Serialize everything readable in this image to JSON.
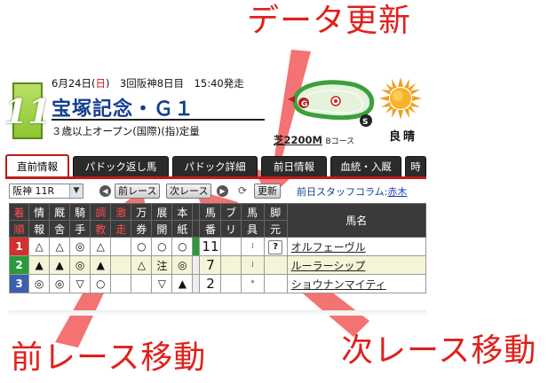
{
  "annotations": {
    "data_update": "データ更新",
    "prev_race_move": "前レース移動",
    "next_race_move": "次レース移動"
  },
  "header": {
    "race_number": "11",
    "date_prefix": "6月24日(",
    "weekday": "日",
    "date_suffix": ")　3回阪神8日目　15:40発走",
    "race_name": "宝塚記念・Ｇ１",
    "conditions": "３歳以上オープン(国際)(指)定量",
    "distance": "芝2200M",
    "course": "Bコース",
    "weather": "良晴",
    "weather_track": "良",
    "weather_sky": "晴"
  },
  "tabs": [
    "直前情報",
    "パドック返し馬",
    "パドック詳細",
    "前日情報",
    "血統・入厩",
    "時"
  ],
  "nav": {
    "race_select": "阪神 11R",
    "prev_label": "前レース",
    "next_label": "次レース",
    "update_label": "更新",
    "column_prefix": "前日スタッフコラム:",
    "column_author": "赤木"
  },
  "table": {
    "headers": [
      {
        "top": "着",
        "bottom": "順",
        "red": true
      },
      {
        "top": "情",
        "bottom": "報",
        "red": false
      },
      {
        "top": "厩",
        "bottom": "舎",
        "red": false
      },
      {
        "top": "騎",
        "bottom": "手",
        "red": false
      },
      {
        "top": "調",
        "bottom": "教",
        "red": true
      },
      {
        "top": "激",
        "bottom": "走",
        "red": true
      },
      {
        "top": "万",
        "bottom": "券",
        "red": false
      },
      {
        "top": "展",
        "bottom": "開",
        "red": false
      },
      {
        "top": "本",
        "bottom": "紙",
        "red": false
      },
      {
        "top": "",
        "bottom": "",
        "red": false
      },
      {
        "top": "馬",
        "bottom": "番",
        "red": false
      },
      {
        "top": "ブ",
        "bottom": "リ",
        "red": false
      },
      {
        "top": "馬",
        "bottom": "具",
        "red": false
      },
      {
        "top": "脚",
        "bottom": "元",
        "red": false
      },
      {
        "top": "馬名",
        "bottom": "",
        "red": false
      }
    ],
    "rows": [
      {
        "waku": "1",
        "waku_color": "#d0312d",
        "marks": [
          "△",
          "△",
          "◎",
          "△",
          "",
          "○",
          "○",
          "○"
        ],
        "umaban": "11",
        "bri": "",
        "gu": "⁞",
        "ashi": "?",
        "name": "オルフェーヴル"
      },
      {
        "waku": "2",
        "waku_color": "#2a9a3a",
        "marks": [
          "▲",
          "▲",
          "◎",
          "▲",
          "",
          "△",
          "注",
          "◎"
        ],
        "umaban": "7",
        "bri": "",
        "gu": "⁞",
        "ashi": "",
        "name": "ルーラーシップ"
      },
      {
        "waku": "3",
        "waku_color": "#3d5fae",
        "marks": [
          "◎",
          "◎",
          "▽",
          "○",
          "",
          "",
          "▽",
          "▲"
        ],
        "umaban": "2",
        "bri": "",
        "gu": "*",
        "ashi": "",
        "name": "ショウナンマイティ"
      }
    ]
  },
  "colors": {
    "annotation": "#e0201c",
    "race_name": "#143f8f",
    "tab_active_border": "#c21a1a",
    "race_number_bg": "#8ec630"
  }
}
